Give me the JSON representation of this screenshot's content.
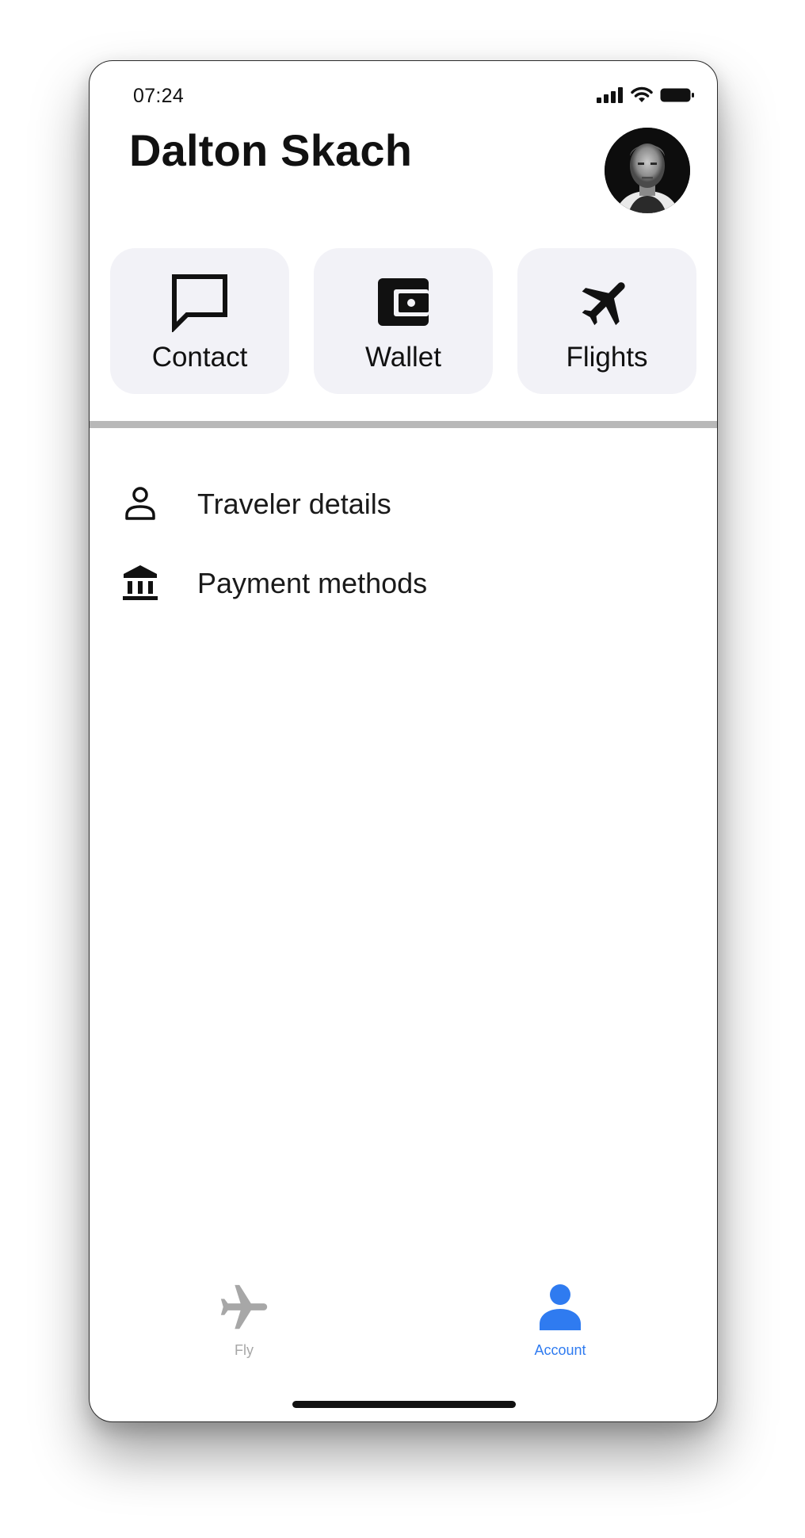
{
  "status_bar": {
    "time": "07:24",
    "icons": [
      "cellular-signal-icon",
      "wifi-icon",
      "battery-icon"
    ]
  },
  "header": {
    "name": "Dalton Skach",
    "avatar_icon": "profile-photo"
  },
  "quick_actions": [
    {
      "label": "Contact",
      "icon": "chat-bubble-icon"
    },
    {
      "label": "Wallet",
      "icon": "wallet-icon"
    },
    {
      "label": "Flights",
      "icon": "airplane-icon"
    }
  ],
  "menu": [
    {
      "label": "Traveler details",
      "icon": "person-icon"
    },
    {
      "label": "Payment methods",
      "icon": "bank-icon"
    }
  ],
  "tab_bar": {
    "tabs": [
      {
        "label": "Fly",
        "icon": "airplane-icon",
        "active": false
      },
      {
        "label": "Account",
        "icon": "person-icon",
        "active": true
      }
    ],
    "active_color": "#2f7bf0",
    "inactive_color": "#a7a7a7"
  }
}
